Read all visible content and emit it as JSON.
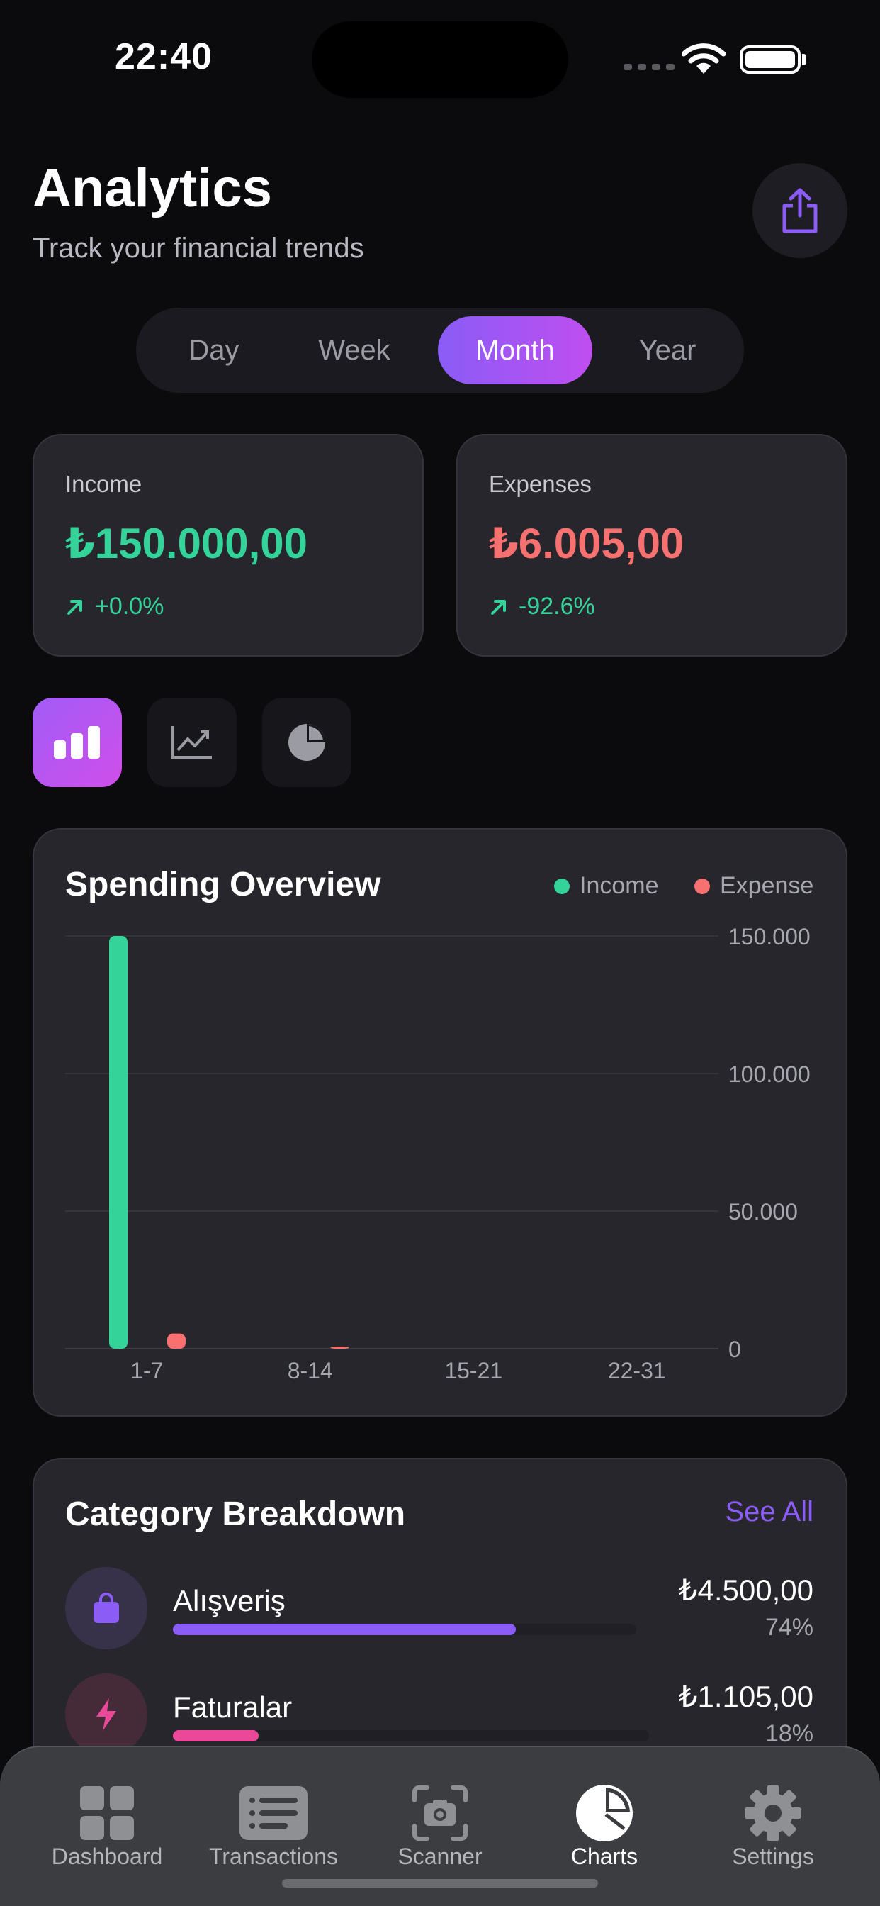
{
  "status": {
    "time": "22:40"
  },
  "header": {
    "title": "Analytics",
    "subtitle": "Track your financial trends"
  },
  "periods": [
    {
      "label": "Day",
      "active": false
    },
    {
      "label": "Week",
      "active": false
    },
    {
      "label": "Month",
      "active": true
    },
    {
      "label": "Year",
      "active": false
    }
  ],
  "income": {
    "label": "Income",
    "value": "₺150.000,00",
    "change": "+0.0%"
  },
  "expenses": {
    "label": "Expenses",
    "value": "₺6.005,00",
    "change": "-92.6%"
  },
  "chart_toggles": [
    "bar-chart-icon",
    "line-chart-icon",
    "pie-chart-icon"
  ],
  "overview": {
    "title": "Spending Overview",
    "legend_income": "Income",
    "legend_expense": "Expense"
  },
  "chart_data": {
    "type": "bar",
    "title": "Spending Overview",
    "categories": [
      "1-7",
      "8-14",
      "15-21",
      "22-31"
    ],
    "series": [
      {
        "name": "Income",
        "color": "#34d399",
        "values": [
          150000,
          0,
          0,
          0
        ]
      },
      {
        "name": "Expense",
        "color": "#f87171",
        "values": [
          5500,
          500,
          0,
          0
        ]
      }
    ],
    "yticks": [
      "0",
      "50.000",
      "100.000",
      "150.000"
    ],
    "ylim": [
      0,
      150000
    ],
    "grid": true,
    "legend": "top-right"
  },
  "categories_section": {
    "title": "Category Breakdown",
    "see_all": "See All",
    "items": [
      {
        "name": "Alışveriş",
        "amount": "₺4.500,00",
        "percent": "74%",
        "fraction": 0.74,
        "color": "#8b5cf6",
        "icon": "shopping-bag-icon"
      },
      {
        "name": "Faturalar",
        "amount": "₺1.105,00",
        "percent": "18%",
        "fraction": 0.18,
        "color": "#ec4899",
        "icon": "lightning-icon"
      }
    ]
  },
  "tabs": [
    {
      "label": "Dashboard",
      "icon": "dashboard-icon"
    },
    {
      "label": "Transactions",
      "icon": "transactions-icon"
    },
    {
      "label": "Scanner",
      "icon": "scanner-icon"
    },
    {
      "label": "Charts",
      "icon": "charts-icon",
      "active": true
    },
    {
      "label": "Settings",
      "icon": "settings-icon"
    }
  ]
}
